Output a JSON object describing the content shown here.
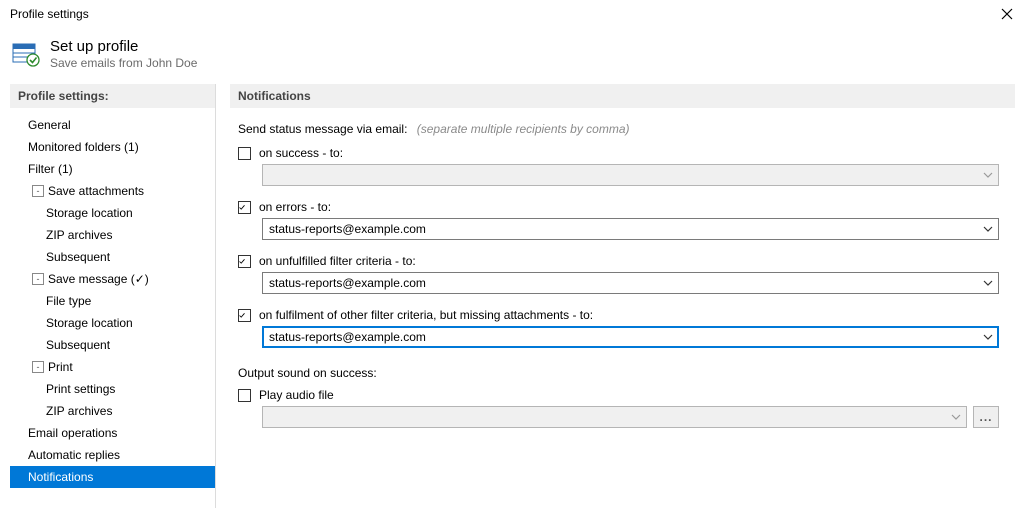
{
  "window": {
    "title": "Profile settings"
  },
  "header": {
    "title": "Set up profile",
    "subtitle": "Save emails from John Doe"
  },
  "sidebar": {
    "title": "Profile settings:",
    "items": [
      "General",
      "Monitored folders (1)",
      "Filter (1)",
      "Save attachments",
      "Storage location",
      "ZIP archives",
      "Subsequent",
      "Save message (✓)",
      "File type",
      "Storage location",
      "Subsequent",
      "Print",
      "Print settings",
      "ZIP archives",
      "Email operations",
      "Automatic replies",
      "Notifications"
    ]
  },
  "main": {
    "title": "Notifications",
    "lead_label": "Send status message via email:",
    "lead_hint": "(separate multiple recipients by comma)",
    "success_label": "on success - to:",
    "success_value": "",
    "errors_label": "on errors - to:",
    "errors_value": "status-reports@example.com",
    "unfulfilled_label": "on unfulfilled filter criteria - to:",
    "unfulfilled_value": "status-reports@example.com",
    "missing_label": "on fulfilment of other filter criteria, but missing attachments - to:",
    "missing_value": "status-reports@example.com",
    "sound_heading": "Output sound on success:",
    "play_audio_label": "Play audio file",
    "audio_path": "",
    "browse_label": "..."
  }
}
